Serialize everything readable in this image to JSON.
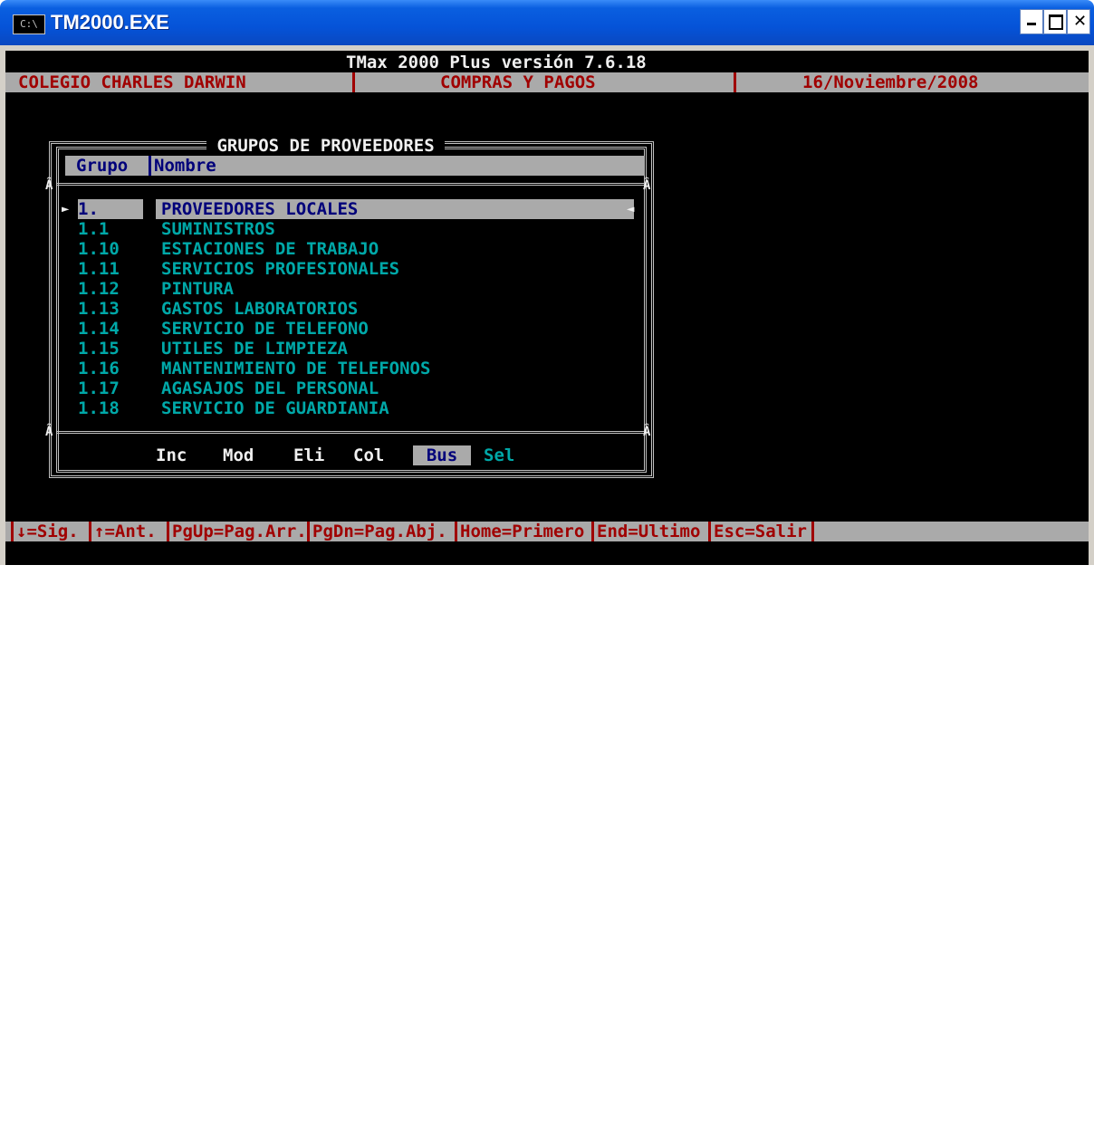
{
  "window": {
    "title": "TM2000.EXE",
    "icon_text": "C:\\"
  },
  "header": {
    "app_title": "TMax 2000 Plus versión 7.6.18",
    "company": "COLEGIO CHARLES DARWIN",
    "module": "COMPRAS Y PAGOS",
    "date": "16/Noviembre/2008"
  },
  "dialog": {
    "title": " GRUPOS DE PROVEEDORES ",
    "col_group": "Grupo",
    "col_name": "Nombre",
    "rows": [
      {
        "code": "1.",
        "name": "PROVEEDORES LOCALES"
      },
      {
        "code": "1.1",
        "name": "SUMINISTROS"
      },
      {
        "code": "1.10",
        "name": "ESTACIONES DE TRABAJO"
      },
      {
        "code": "1.11",
        "name": "SERVICIOS PROFESIONALES"
      },
      {
        "code": "1.12",
        "name": "PINTURA"
      },
      {
        "code": "1.13",
        "name": "GASTOS LABORATORIOS"
      },
      {
        "code": "1.14",
        "name": "SERVICIO DE TELEFONO"
      },
      {
        "code": "1.15",
        "name": "UTILES DE LIMPIEZA"
      },
      {
        "code": "1.16",
        "name": "MANTENIMIENTO DE TELEFONOS"
      },
      {
        "code": "1.17",
        "name": "AGASAJOS DEL PERSONAL"
      },
      {
        "code": "1.18",
        "name": "SERVICIO DE GUARDIANIA"
      }
    ],
    "selected_index": 0,
    "actions": {
      "inc": "Inc",
      "mod": "Mod",
      "eli": "Eli",
      "col": "Col",
      "bus": "Bus",
      "sel": "Sel"
    }
  },
  "footer": {
    "keys": [
      "↓=Sig.",
      "↑=Ant.",
      "PgUp=Pag.Arr.",
      "PgDn=Pag.Abj.",
      "Home=Primero",
      "End=Ultimo",
      "Esc=Salir"
    ]
  },
  "colors": {
    "header_text": "#a00000",
    "highlight": "#aaaaaa",
    "list_text": "#00a8a8",
    "selected_text": "#00007a"
  }
}
